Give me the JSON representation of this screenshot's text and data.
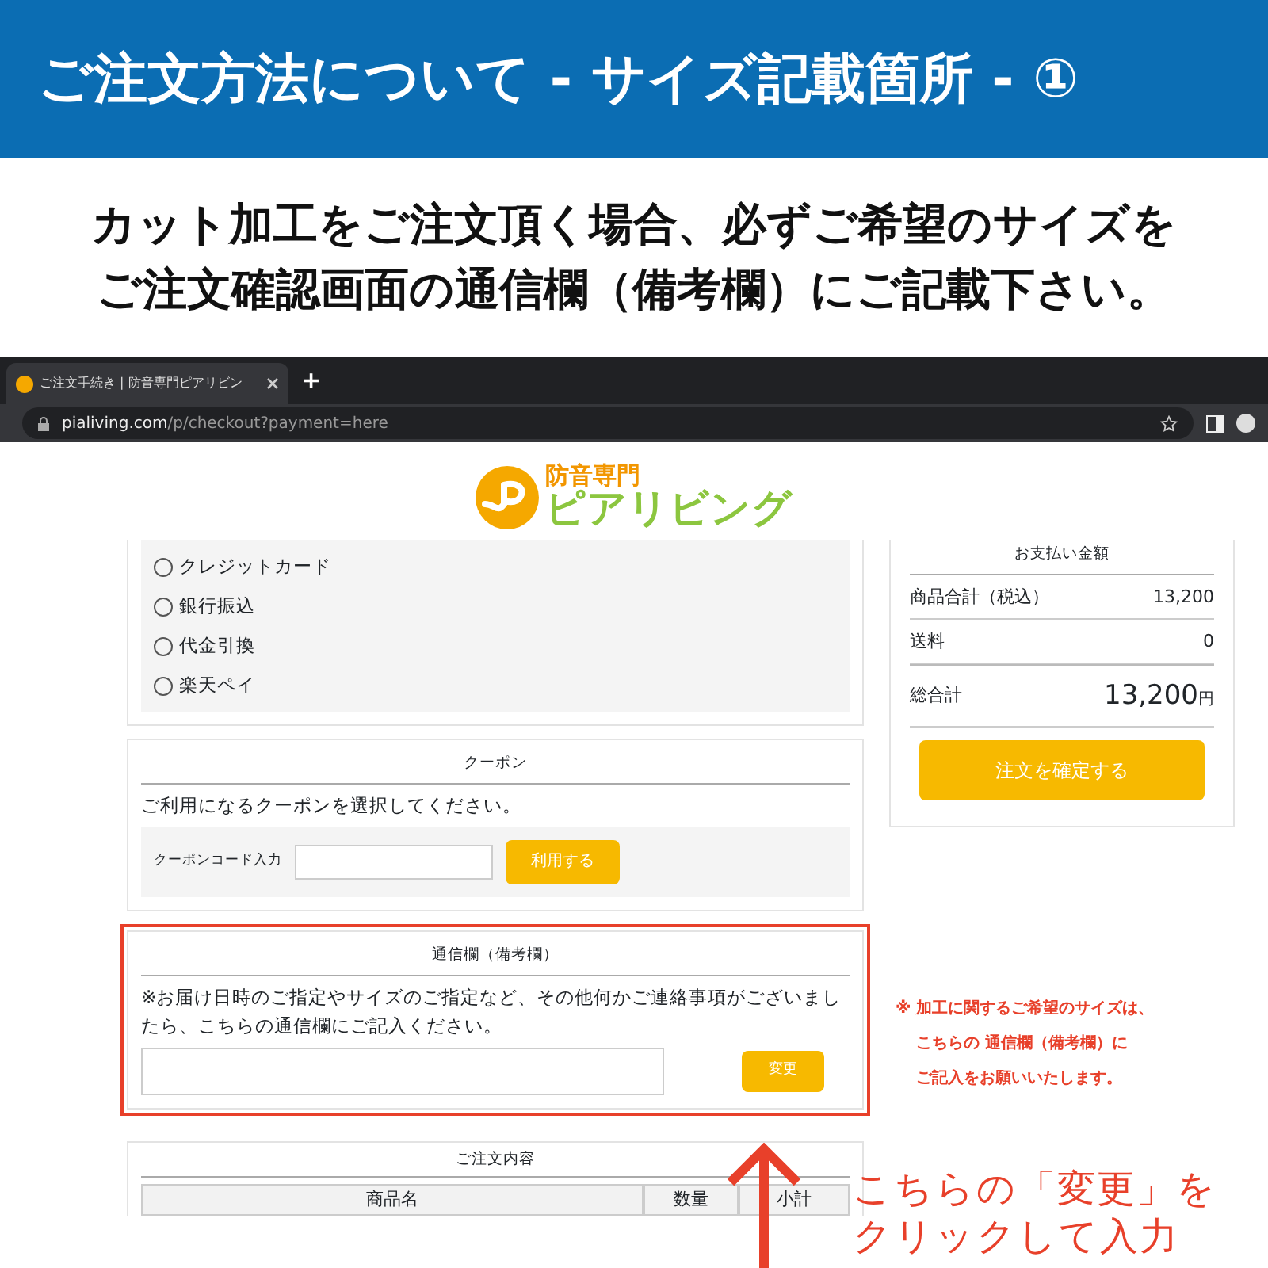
{
  "banner": {
    "title": "ご注文方法について - サイズ記載箇所 - ①"
  },
  "instruction": {
    "lines": [
      "カット加工をご注文頂く場合、必ずご希望のサイズを",
      "ご注文確認画面の通信欄（備考欄）にご記載下さい。"
    ]
  },
  "browser": {
    "tab_title": "ご注文手続き | 防音専門ピアリビン",
    "new_tab": "+",
    "url_host": "pialiving.com",
    "url_path": "/p/checkout?payment=here"
  },
  "logo": {
    "small": "防音専門",
    "large": "ピアリビング"
  },
  "payment_methods": [
    {
      "label": "クレジットカード",
      "selected": false
    },
    {
      "label": "銀行振込",
      "selected": false
    },
    {
      "label": "代金引換",
      "selected": false
    },
    {
      "label": "楽天ペイ",
      "selected": false
    }
  ],
  "coupon": {
    "title": "クーポン",
    "description": "ご利用になるクーポンを選択してください。",
    "code_label": "クーポンコード入力",
    "button": "利用する"
  },
  "notes": {
    "title": "通信欄（備考欄）",
    "description": "※お届け日時のご指定やサイズのご指定など、その他何かご連絡事項がございましたら、こちらの通信欄にご記入ください。",
    "button": "変更"
  },
  "order_contents": {
    "title": "ご注文内容",
    "columns": [
      "商品名",
      "数量",
      "小計"
    ]
  },
  "summary": {
    "title": "お支払い金額",
    "rows": [
      {
        "label": "商品合計（税込）",
        "value": "13,200"
      },
      {
        "label": "送料",
        "value": "0"
      }
    ],
    "total_label": "総合計",
    "total_value": "13,200",
    "currency": "円",
    "button": "注文を確定する"
  },
  "annotation": {
    "note_lines": [
      "※ 加工に関するご希望のサイズは、",
      "こちらの 通信欄（備考欄）に",
      "ご記入をお願いいたします。"
    ],
    "callout_lines": [
      "こちらの「変更」を",
      "クリックして入力"
    ]
  }
}
